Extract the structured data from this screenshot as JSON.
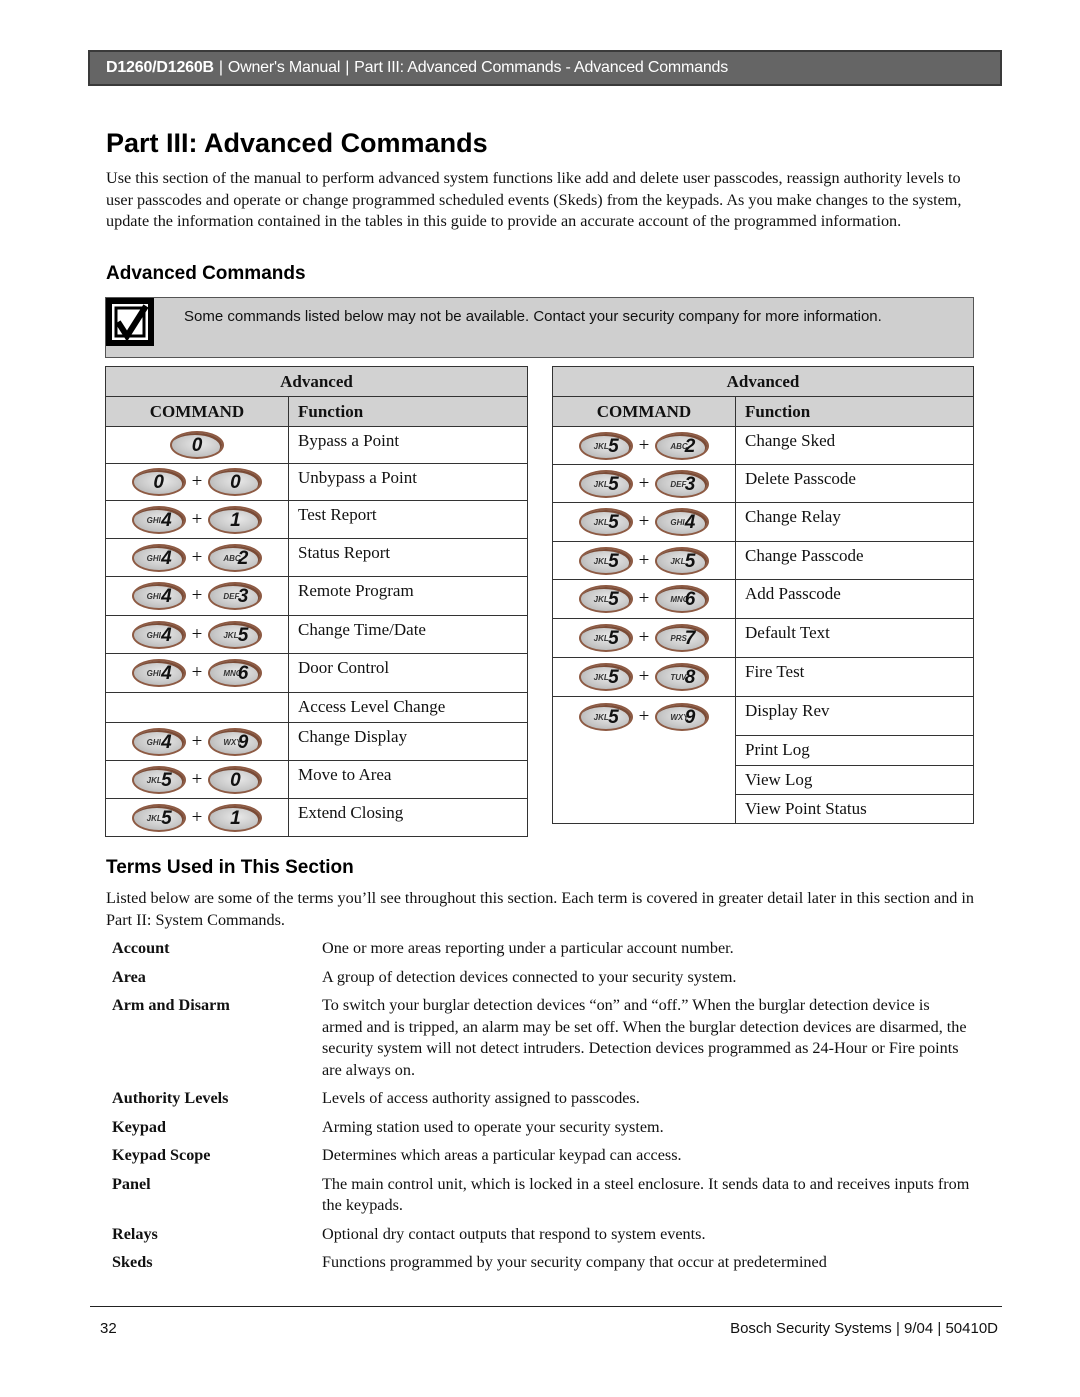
{
  "header": {
    "product": "D1260/D1260B",
    "separator": "|",
    "manual": "Owner's Manual",
    "section": "Part III: Advanced Commands - Advanced Commands"
  },
  "page_title": "Part III: Advanced Commands",
  "intro": "Use this section of the manual to perform advanced system functions like add and delete user passcodes, reassign authority levels to user passcodes and operate or change programmed scheduled events (Skeds) from the keypads. As you make changes to the system, update the information contained in the tables in this guide to provide an accurate account of the programmed information.",
  "advanced_heading": "Advanced Commands",
  "note": {
    "icon": "checkbox-checked-icon",
    "text": "Some commands listed below may not be available. Contact your security company for more information."
  },
  "tables": [
    {
      "title": "Advanced",
      "col_command": "COMMAND",
      "col_function": "Function",
      "rows": [
        {
          "keys": [
            {
              "letters": "",
              "digit": "0"
            }
          ],
          "function": "Bypass a Point"
        },
        {
          "keys": [
            {
              "letters": "",
              "digit": "0"
            },
            {
              "letters": "",
              "digit": "0"
            }
          ],
          "function": "Unbypass a Point"
        },
        {
          "keys": [
            {
              "letters": "GHI",
              "digit": "4"
            },
            {
              "letters": "",
              "digit": "1"
            }
          ],
          "function": "Test Report"
        },
        {
          "keys": [
            {
              "letters": "GHI",
              "digit": "4"
            },
            {
              "letters": "ABC",
              "digit": "2"
            }
          ],
          "function": "Status Report"
        },
        {
          "keys": [
            {
              "letters": "GHI",
              "digit": "4"
            },
            {
              "letters": "DEF",
              "digit": "3"
            }
          ],
          "function": "Remote Program"
        },
        {
          "keys": [
            {
              "letters": "GHI",
              "digit": "4"
            },
            {
              "letters": "JKL",
              "digit": "5"
            }
          ],
          "function": "Change Time/Date"
        },
        {
          "keys": [
            {
              "letters": "GHI",
              "digit": "4"
            },
            {
              "letters": "MNO",
              "digit": "6"
            }
          ],
          "function": "Door Control"
        },
        {
          "keys": [],
          "function": "Access Level Change"
        },
        {
          "keys": [
            {
              "letters": "GHI",
              "digit": "4"
            },
            {
              "letters": "WXY",
              "digit": "9"
            }
          ],
          "function": "Change Display"
        },
        {
          "keys": [
            {
              "letters": "JKL",
              "digit": "5"
            },
            {
              "letters": "",
              "digit": "0"
            }
          ],
          "function": "Move to Area"
        },
        {
          "keys": [
            {
              "letters": "JKL",
              "digit": "5"
            },
            {
              "letters": "",
              "digit": "1"
            }
          ],
          "function": "Extend Closing"
        }
      ]
    },
    {
      "title": "Advanced",
      "col_command": "COMMAND",
      "col_function": "Function",
      "rows": [
        {
          "keys": [
            {
              "letters": "JKL",
              "digit": "5"
            },
            {
              "letters": "ABC",
              "digit": "2"
            }
          ],
          "function": "Change Sked"
        },
        {
          "keys": [
            {
              "letters": "JKL",
              "digit": "5"
            },
            {
              "letters": "DEF",
              "digit": "3"
            }
          ],
          "function": "Delete Passcode"
        },
        {
          "keys": [
            {
              "letters": "JKL",
              "digit": "5"
            },
            {
              "letters": "GHI",
              "digit": "4"
            }
          ],
          "function": "Change Relay"
        },
        {
          "keys": [
            {
              "letters": "JKL",
              "digit": "5"
            },
            {
              "letters": "JKL",
              "digit": "5"
            }
          ],
          "function": "Change Passcode"
        },
        {
          "keys": [
            {
              "letters": "JKL",
              "digit": "5"
            },
            {
              "letters": "MNO",
              "digit": "6"
            }
          ],
          "function": "Add Passcode"
        },
        {
          "keys": [
            {
              "letters": "JKL",
              "digit": "5"
            },
            {
              "letters": "PRS",
              "digit": "7"
            }
          ],
          "function": "Default Text"
        },
        {
          "keys": [
            {
              "letters": "JKL",
              "digit": "5"
            },
            {
              "letters": "TUV",
              "digit": "8"
            }
          ],
          "function": "Fire Test"
        },
        {
          "keys": [
            {
              "letters": "JKL",
              "digit": "5"
            },
            {
              "letters": "WXY",
              "digit": "9"
            }
          ],
          "function": "Display Rev"
        },
        {
          "keys": [],
          "function": "Print Log"
        },
        {
          "keys": [],
          "function": "View Log"
        },
        {
          "keys": [],
          "function": "View Point Status"
        }
      ]
    }
  ],
  "plus_sign": "+",
  "terms_heading": "Terms Used in This Section",
  "terms_intro": "Listed below are some of the terms you’ll see throughout this section. Each term is covered in greater detail later in this section and in Part II: System Commands.",
  "terms": [
    {
      "term": "Account",
      "definition": "One or more areas reporting under a particular account number."
    },
    {
      "term": "Area",
      "definition": "A group of detection devices connected to your security system."
    },
    {
      "term": "Arm and Disarm",
      "definition": "To switch your burglar detection devices “on” and “off.” When the burglar detection device is armed and is tripped, an alarm may be set off. When the burglar detection devices are disarmed, the security system will not detect intruders. Detection devices programmed as 24-Hour or Fire points are always on."
    },
    {
      "term": "Authority Levels",
      "definition": "Levels of access authority assigned to passcodes."
    },
    {
      "term": "Keypad",
      "definition": "Arming station used to operate your security system."
    },
    {
      "term": "Keypad Scope",
      "definition": "Determines which areas a particular keypad can access."
    },
    {
      "term": "Panel",
      "definition": "The main control unit, which is locked in a steel enclosure. It sends data to and receives inputs from the keypads."
    },
    {
      "term": "Relays",
      "definition": "Optional dry contact outputs that respond to system events."
    },
    {
      "term": "Skeds",
      "definition": "Functions programmed by your security company that occur at predetermined"
    }
  ],
  "footer": {
    "page_number": "32",
    "publisher": "Bosch Security Systems | 9/04 | 50410D"
  }
}
